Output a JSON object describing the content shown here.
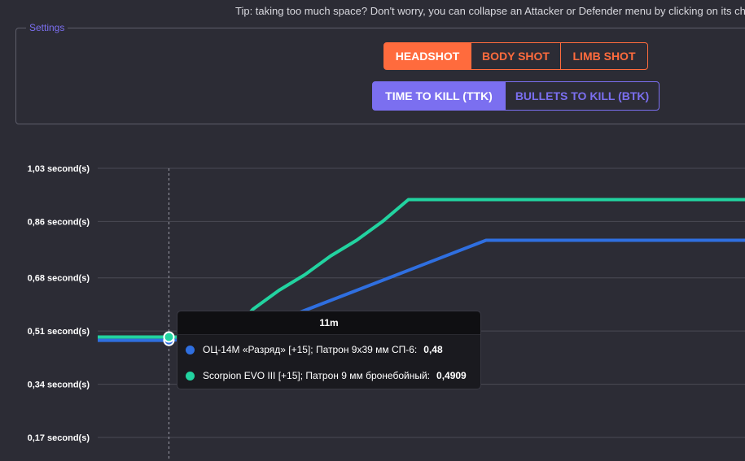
{
  "tip": "Tip: taking too much space? Don't worry, you can collapse an Attacker or Defender menu by clicking on its chevron",
  "settings": {
    "legend": "Settings",
    "shot_buttons": [
      {
        "label": "HEADSHOT",
        "active": true
      },
      {
        "label": "BODY SHOT",
        "active": false
      },
      {
        "label": "LIMB SHOT",
        "active": false
      }
    ],
    "metric_buttons": [
      {
        "label": "TIME TO KILL (TTK)",
        "active": true
      },
      {
        "label": "BULLETS TO KILL (BTK)",
        "active": false
      }
    ]
  },
  "colors": {
    "background": "#2c2c35",
    "accent_orange": "#ff6b3d",
    "accent_purple": "#7b6ff0",
    "series_blue": "#2f6fe0",
    "series_green": "#22d3a0"
  },
  "chart_data": {
    "type": "line",
    "title": "",
    "xlabel": "",
    "ylabel": "",
    "ylim": [
      0.17,
      1.03
    ],
    "y_ticks": [
      "1,03 second(s)",
      "0,86 second(s)",
      "0,68 second(s)",
      "0,51 second(s)",
      "0,34 second(s)",
      "0,17 second(s)"
    ],
    "y_tick_values": [
      1.03,
      0.86,
      0.68,
      0.51,
      0.34,
      0.17
    ],
    "grid": true,
    "hover_x": 11,
    "series": [
      {
        "name": "ОЦ-14М «Разряд» [+15]; Патрон 9х39 мм СП-6",
        "color": "#2f6fe0",
        "x": [
          0,
          11,
          25,
          30,
          40,
          50,
          60,
          100
        ],
        "y": [
          0.48,
          0.48,
          0.5,
          0.56,
          0.64,
          0.72,
          0.8,
          0.8
        ]
      },
      {
        "name": "Scorpion EVO III [+15]; Патрон 9 мм бронебойный",
        "color": "#22d3a0",
        "x": [
          0,
          11,
          20,
          24,
          28,
          32,
          36,
          40,
          44,
          48,
          100
        ],
        "y": [
          0.4909,
          0.4909,
          0.49,
          0.58,
          0.64,
          0.69,
          0.75,
          0.8,
          0.86,
          0.93,
          0.93
        ]
      }
    ]
  },
  "tooltip": {
    "header": "11m",
    "rows": [
      {
        "label": "ОЦ-14М «Разряд» [+15]; Патрон 9х39 мм СП-6:",
        "value": "0,48",
        "color": "#2f6fe0"
      },
      {
        "label": "Scorpion EVO III [+15]; Патрон 9 мм бронебойный:",
        "value": "0,4909",
        "color": "#22d3a0"
      }
    ]
  }
}
